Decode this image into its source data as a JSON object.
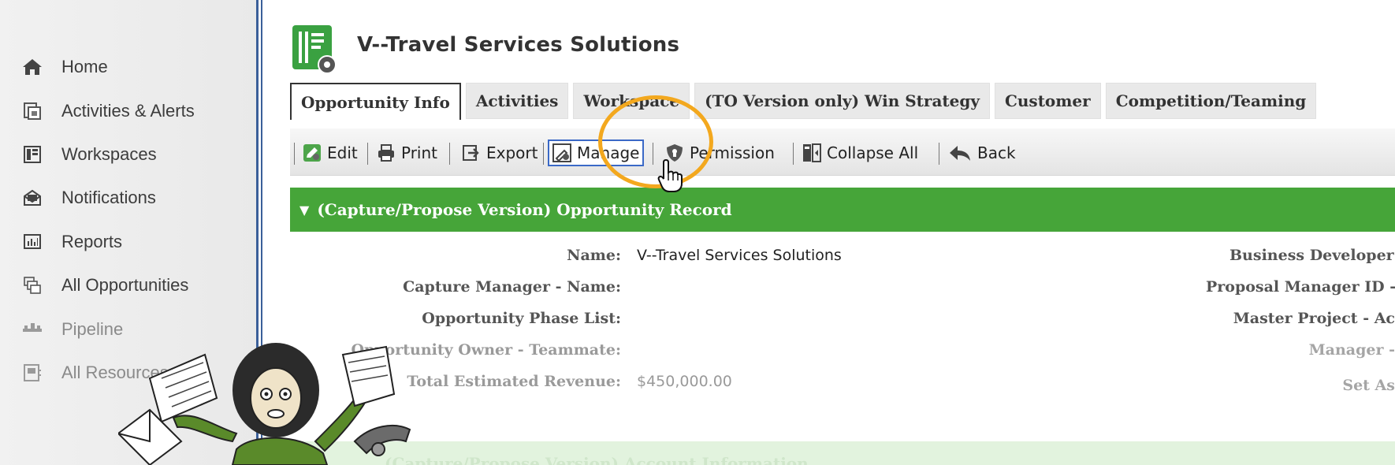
{
  "sidebar": {
    "items": [
      {
        "label": "Home",
        "icon": "home-icon"
      },
      {
        "label": "Activities & Alerts",
        "icon": "activities-icon"
      },
      {
        "label": "Workspaces",
        "icon": "workspaces-icon"
      },
      {
        "label": "Notifications",
        "icon": "notifications-icon"
      },
      {
        "label": "Reports",
        "icon": "reports-icon"
      },
      {
        "label": "All Opportunities",
        "icon": "opportunities-icon"
      },
      {
        "label": "Pipeline",
        "icon": "pipeline-icon"
      },
      {
        "label": "All Resources",
        "icon": "resources-icon"
      }
    ]
  },
  "header": {
    "title": "V--Travel Services Solutions",
    "logo_icon": "opportunity-record-icon"
  },
  "tabs": [
    {
      "label": "Opportunity Info",
      "active": true
    },
    {
      "label": "Activities",
      "active": false
    },
    {
      "label": "Workspace",
      "active": false
    },
    {
      "label": "(TO Version only) Win Strategy",
      "active": false
    },
    {
      "label": "Customer",
      "active": false
    },
    {
      "label": "Competition/Teaming",
      "active": false
    }
  ],
  "toolbar": {
    "edit": "Edit",
    "print": "Print",
    "export": "Export",
    "manage": "Manage",
    "permission": "Permission",
    "collapse_all": "Collapse All",
    "back": "Back"
  },
  "section": {
    "title": "(Capture/Propose Version) Opportunity Record",
    "next_title": "(Capture/Propose Version) Account Information"
  },
  "fields": [
    {
      "label": "Name:",
      "value": "V--Travel Services Solutions"
    },
    {
      "label": "Capture Manager - Name:",
      "value": ""
    },
    {
      "label": "Opportunity Phase List:",
      "value": ""
    },
    {
      "label": "Opportunity Owner - Teammate:",
      "value": ""
    },
    {
      "label": "Total Estimated Revenue:",
      "value": "$450,000.00"
    }
  ],
  "right_fields": [
    {
      "label": "Business Developer -"
    },
    {
      "label": "Proposal Manager ID -"
    },
    {
      "label": "Master Project - Ac"
    },
    {
      "label": "Manager -"
    },
    {
      "label": "Set As"
    }
  ],
  "colors": {
    "section_green": "#46a539",
    "sidebar_divider": "#3a5f99",
    "highlight_ring": "#f3a81e",
    "focus_border": "#3b69c7"
  }
}
